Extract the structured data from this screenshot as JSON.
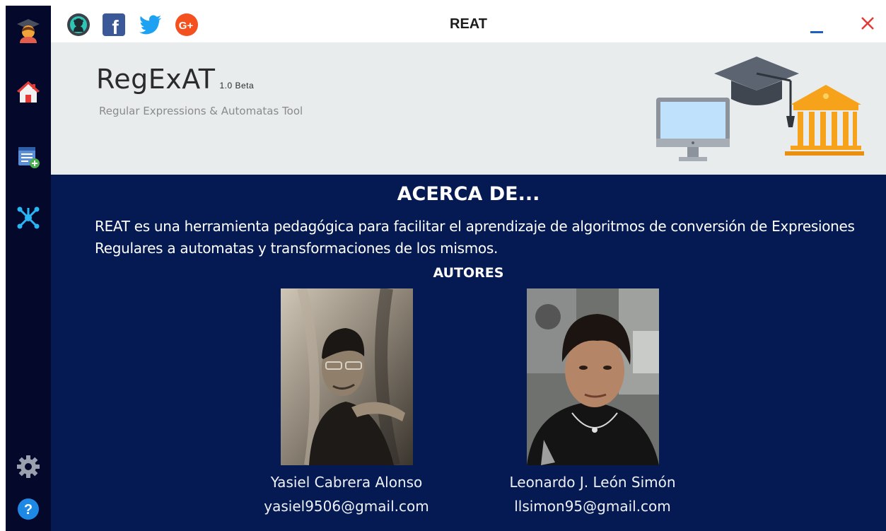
{
  "window": {
    "title": "REAT"
  },
  "sidebar": {
    "items": [
      {
        "icon": "graduate-avatar-icon"
      },
      {
        "icon": "home-icon"
      },
      {
        "icon": "add-list-icon"
      },
      {
        "icon": "network-icon"
      },
      {
        "icon": "gear-icon"
      },
      {
        "icon": "help-icon"
      }
    ]
  },
  "social": [
    {
      "icon": "github-icon"
    },
    {
      "icon": "facebook-icon"
    },
    {
      "icon": "twitter-icon"
    },
    {
      "icon": "google-plus-icon"
    }
  ],
  "banner": {
    "app_name": "RegExAT",
    "version": "1.0 Beta",
    "subtitle": "Regular Expressions & Automatas Tool"
  },
  "about": {
    "title": "ACERCA DE...",
    "description": "REAT es una herramienta pedagógica para facilitar el aprendizaje de algoritmos de conversión de Expresiones Regulares a automatas y transformaciones de los mismos.",
    "authors_title": "AUTORES"
  },
  "authors": [
    {
      "name": "Yasiel Cabrera Alonso",
      "email": "yasiel9506@gmail.com"
    },
    {
      "name": "Leonardo J. León Simón",
      "email": "llsimon95@gmail.com"
    }
  ],
  "colors": {
    "sidebar": "#04082b",
    "content": "#051a52",
    "banner": "#e8eced",
    "close": "#e53935",
    "minimize": "#1f5fbf"
  }
}
